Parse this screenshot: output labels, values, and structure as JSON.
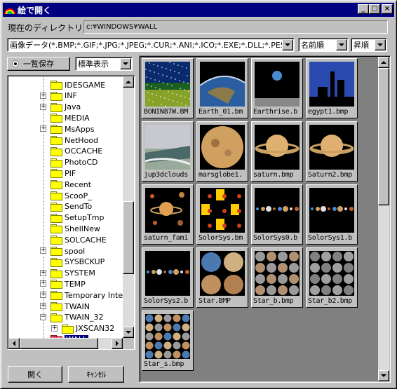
{
  "window": {
    "title": "絵で開く"
  },
  "titlebar": {
    "min": "_",
    "max": "□",
    "close": "×"
  },
  "dir": {
    "label": "現在のディレクトリ",
    "path": "c:¥WINDOWS¥WALL"
  },
  "filter": {
    "value": "画像データ(*.BMP;*.GIF;*.JPG;*.JPEG;*.CUR;*.ANI;*.ICO;*.EXE;*.DLL;*.PESN)"
  },
  "sort": {
    "value": "名前順"
  },
  "order": {
    "value": "昇順"
  },
  "options": {
    "save_list": "一覧保存",
    "view_mode": "標準表示"
  },
  "tree": {
    "items": [
      {
        "label": "IDESGAME",
        "plus": false
      },
      {
        "label": "INF",
        "plus": true
      },
      {
        "label": "Java",
        "plus": true
      },
      {
        "label": "MEDIA",
        "plus": false
      },
      {
        "label": "MsApps",
        "plus": true
      },
      {
        "label": "NetHood",
        "plus": false
      },
      {
        "label": "OCCACHE",
        "plus": false
      },
      {
        "label": "PhotoCD",
        "plus": false
      },
      {
        "label": "PIF",
        "plus": false
      },
      {
        "label": "Recent",
        "plus": false
      },
      {
        "label": "ScooP_",
        "plus": false
      },
      {
        "label": "SendTo",
        "plus": false
      },
      {
        "label": "SetupTmp",
        "plus": false
      },
      {
        "label": "ShellNew",
        "plus": false
      },
      {
        "label": "SOLCACHE",
        "plus": false
      },
      {
        "label": "spool",
        "plus": true
      },
      {
        "label": "SYSBCKUP",
        "plus": false
      },
      {
        "label": "SYSTEM",
        "plus": true
      },
      {
        "label": "TEMP",
        "plus": true
      },
      {
        "label": "Temporary Inter",
        "plus": true
      },
      {
        "label": "TWAIN",
        "plus": true
      },
      {
        "label": "TWAIN_32",
        "plus": "minus"
      },
      {
        "label": "JXSCAN32",
        "plus": true,
        "indent": true
      },
      {
        "label": "WALL",
        "plus": false,
        "selected": true
      }
    ]
  },
  "thumbs": [
    {
      "caption": "BONIN87W.BM",
      "icon": "stars-sky"
    },
    {
      "caption": "Earth_01.bm",
      "icon": "earth-orbit"
    },
    {
      "caption": "Earthrise.b",
      "icon": "earthrise"
    },
    {
      "caption": "egypt1.bmp",
      "icon": "egypt-skyline"
    },
    {
      "caption": "jup3dclouds",
      "icon": "clouds"
    },
    {
      "caption": "marsglobe1.",
      "icon": "mars"
    },
    {
      "caption": "saturn.bmp",
      "icon": "saturn"
    },
    {
      "caption": "Saturn2.bmp",
      "icon": "saturn"
    },
    {
      "caption": "saturn_fami",
      "icon": "saturn-family"
    },
    {
      "caption": "SolorSys.bm",
      "icon": "solar-tiles"
    },
    {
      "caption": "SolorSys0.b",
      "icon": "solar-row"
    },
    {
      "caption": "SolorSys1.b",
      "icon": "solar-row"
    },
    {
      "caption": "SolorSys2.b",
      "icon": "solar-row"
    },
    {
      "caption": "Star.BMP",
      "icon": "planets-grid"
    },
    {
      "caption": "Star_b.bmp",
      "icon": "moons-grid"
    },
    {
      "caption": "Star_b2.bmp",
      "icon": "moons-grid-gray"
    },
    {
      "caption": "Star_s.bmp",
      "icon": "planets-grid-small"
    }
  ],
  "buttons": {
    "open": "開く",
    "cancel": "ｷｬﾝｾﾙ"
  }
}
